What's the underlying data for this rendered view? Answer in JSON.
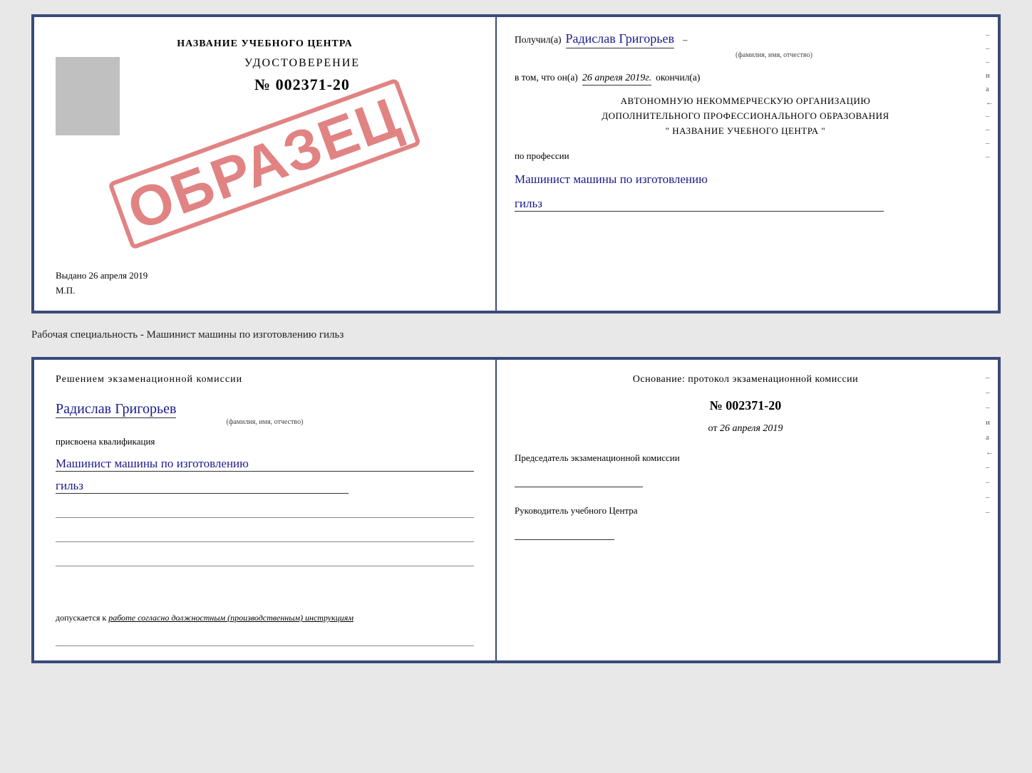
{
  "top_cert": {
    "left": {
      "school_name": "НАЗВАНИЕ УЧЕБНОГО ЦЕНТРА",
      "photo_alt": "фото",
      "udost_label": "УДОСТОВЕРЕНИЕ",
      "cert_number": "№ 002371-20",
      "stamp": "ОБРАЗЕЦ",
      "vydano": "Выдано 26 апреля 2019",
      "mp": "М.П."
    },
    "right": {
      "poluchil_label": "Получил(а)",
      "person_name": "Радислав Григорьев",
      "fio_sub": "(фамилия, имя, отчество)",
      "vtom_label": "в том, что он(а)",
      "date_field": "26 апреля 2019г.",
      "okonchil": "окончил(а)",
      "org_line1": "АВТОНОМНУЮ НЕКОММЕРЧЕСКУЮ ОРГАНИЗАЦИЮ",
      "org_line2": "ДОПОЛНИТЕЛЬНОГО ПРОФЕССИОНАЛЬНОГО ОБРАЗОВАНИЯ",
      "org_line3": "\"  НАЗВАНИЕ УЧЕБНОГО ЦЕНТРА  \"",
      "po_professii": "по профессии",
      "profession_handwritten": "Машинист машины по изготовлению",
      "profession_handwritten2": "гильз",
      "dashes": [
        "–",
        "–",
        "–",
        "и",
        "а",
        "←",
        "–",
        "–",
        "–",
        "–"
      ]
    }
  },
  "between_label": "Рабочая специальность - Машинист машины по изготовлению гильз",
  "bottom_cert": {
    "left": {
      "decision_text": "Решением  экзаменационной  комиссии",
      "person_name": "Радислав Григорьев",
      "fio_sub": "(фамилия, имя, отчество)",
      "assigned_text": "присвоена квалификация",
      "qual_line1": "Машинист машины по изготовлению",
      "qual_line2": "гильз",
      "dopuskaetsya_label": "допускается к",
      "dopuskaetsya_text": "работе согласно должностным (производственным) инструкциям"
    },
    "right": {
      "osnov_text": "Основание: протокол экзаменационной  комиссии",
      "protocol_label": "№",
      "protocol_number": "002371-20",
      "ot_label": "от",
      "ot_date": "26 апреля 2019",
      "chairman_label": "Председатель экзаменационной комиссии",
      "head_label": "Руководитель учебного Центра",
      "dashes": [
        "–",
        "–",
        "–",
        "и",
        "а",
        "←",
        "–",
        "–",
        "–",
        "–"
      ]
    }
  }
}
